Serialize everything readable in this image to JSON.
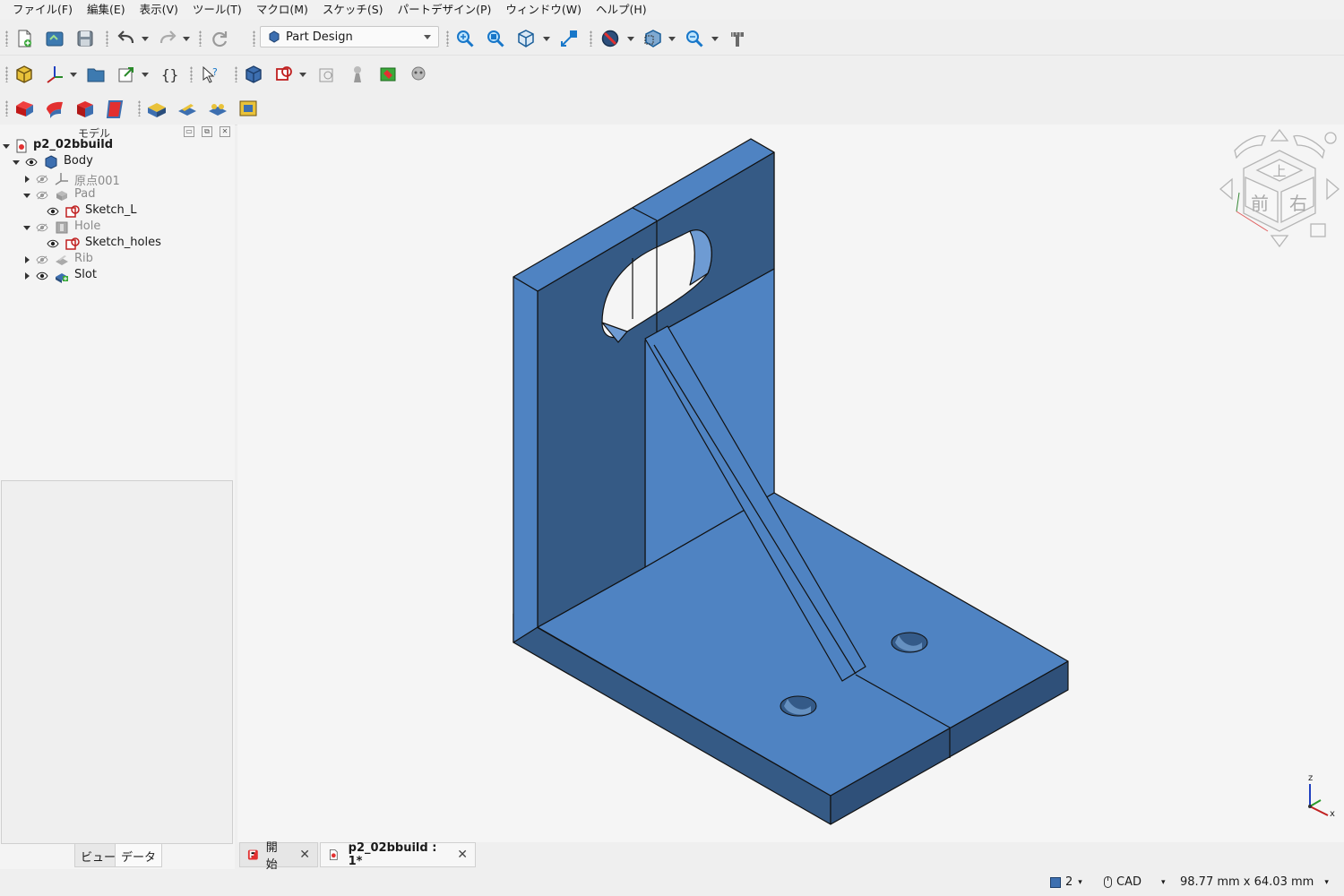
{
  "menubar": {
    "items": [
      "ファイル(F)",
      "編集(E)",
      "表示(V)",
      "ツール(T)",
      "マクロ(M)",
      "スケッチ(S)",
      "パートデザイン(P)",
      "ウィンドウ(W)",
      "ヘルプ(H)"
    ]
  },
  "toolbar": {
    "workbench": "Part Design"
  },
  "panel": {
    "title": "モデル",
    "tabs": [
      "ビュー",
      "データ"
    ]
  },
  "tree": {
    "document": "p2_02bbuild",
    "items": [
      {
        "label": "Body",
        "icon": "body-icon"
      },
      {
        "label": "原点001",
        "icon": "origin-icon"
      },
      {
        "label": "Pad",
        "icon": "pad-icon"
      },
      {
        "label": "Sketch_L",
        "icon": "sketch-icon"
      },
      {
        "label": "Hole",
        "icon": "hole-icon"
      },
      {
        "label": "Sketch_holes",
        "icon": "sketch-icon"
      },
      {
        "label": "Rib",
        "icon": "rib-icon"
      },
      {
        "label": "Slot",
        "icon": "slot-icon"
      }
    ]
  },
  "navcube": {
    "top": "上",
    "front": "前",
    "right": "右"
  },
  "axis": {
    "z": "z",
    "x": "x"
  },
  "doc_tabs": [
    {
      "label": "開始",
      "close": "✕"
    },
    {
      "label": "p2_02bbuild : 1*",
      "close": "✕"
    }
  ],
  "status": {
    "count": "2",
    "nav_style": "CAD",
    "dimensions": "98.77 mm x 64.03 mm"
  },
  "colors": {
    "model_face_light": "#4f83c2",
    "model_face_dark": "#355a85",
    "background": "#f5f5f5"
  }
}
